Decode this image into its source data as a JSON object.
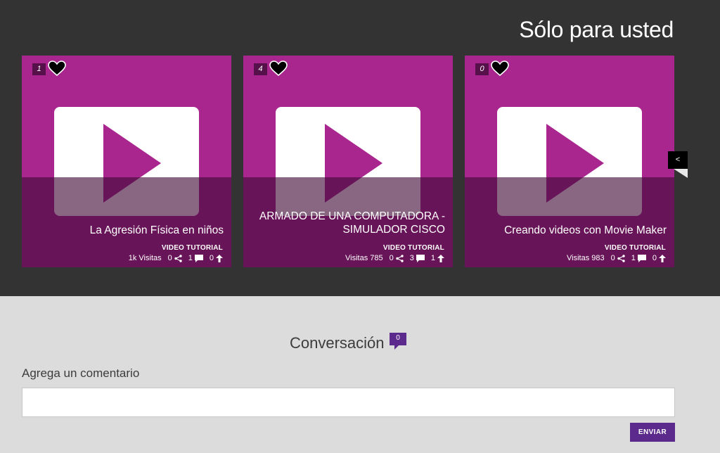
{
  "section": {
    "title": "Sólo para usted"
  },
  "colors": {
    "card_bg": "#a9268f",
    "overlay": "#410a37",
    "band_bg": "#333333",
    "accent": "#5b2a8c"
  },
  "cards": [
    {
      "likes": "1",
      "title": "La Agresión Física en niños",
      "type": "VIDEO TUTORIAL",
      "visits": "1k Visitas",
      "shares": "0",
      "comments": "1",
      "votes": "0"
    },
    {
      "likes": "4",
      "title_line1": "ARMADO DE UNA COMPUTADORA -",
      "title_line2": "SIMULADOR CISCO",
      "type": "VIDEO TUTORIAL",
      "visits": "Visitas 785",
      "shares": "0",
      "comments": "3",
      "votes": "1"
    },
    {
      "likes": "0",
      "title": "Creando videos con Movie Maker",
      "type": "VIDEO TUTORIAL",
      "visits": "Visitas 983",
      "shares": "0",
      "comments": "1",
      "votes": "0"
    }
  ],
  "carousel": {
    "prev_label": "<"
  },
  "conversation": {
    "title": "Conversación",
    "count": "0",
    "comment_label": "Agrega un comentario",
    "comment_value": "",
    "send_label": "ENVIAR"
  },
  "icons": {
    "like": "heart-icon",
    "share": "share-icon",
    "comment": "comment-icon",
    "vote": "arrow-up-icon",
    "play": "play-icon"
  }
}
